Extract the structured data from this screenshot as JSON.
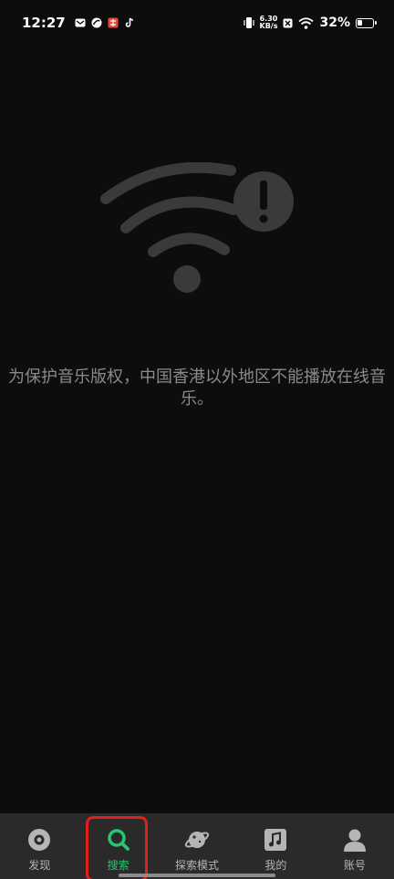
{
  "status_bar": {
    "time": "12:27",
    "net_speed_value": "6.30",
    "net_speed_unit": "KB/s",
    "battery_percent": "32%",
    "battery_level": 0.32,
    "notification_icons": [
      "mail-icon",
      "swirl-app-icon",
      "red-app-icon",
      "tiktok-icon"
    ]
  },
  "main": {
    "message": "为保护音乐版权，中国香港以外地区不能播放在线音乐。",
    "graphic_icon": "wifi-alert-icon"
  },
  "bottom_nav": {
    "items": [
      {
        "label": "发现",
        "icon": "disc-icon",
        "active": false
      },
      {
        "label": "搜索",
        "icon": "search-icon",
        "active": true
      },
      {
        "label": "探索模式",
        "icon": "planet-icon",
        "active": false
      },
      {
        "label": "我的",
        "icon": "music-note-icon",
        "active": false
      },
      {
        "label": "账号",
        "icon": "user-icon",
        "active": false
      }
    ]
  },
  "colors": {
    "background": "#0d0d0d",
    "nav_background": "#2a2a2a",
    "accent_green": "#27c76f",
    "highlight_red": "#e0201c",
    "graphic_gray": "#3a3a3a",
    "message_gray": "#8a8a8a"
  }
}
